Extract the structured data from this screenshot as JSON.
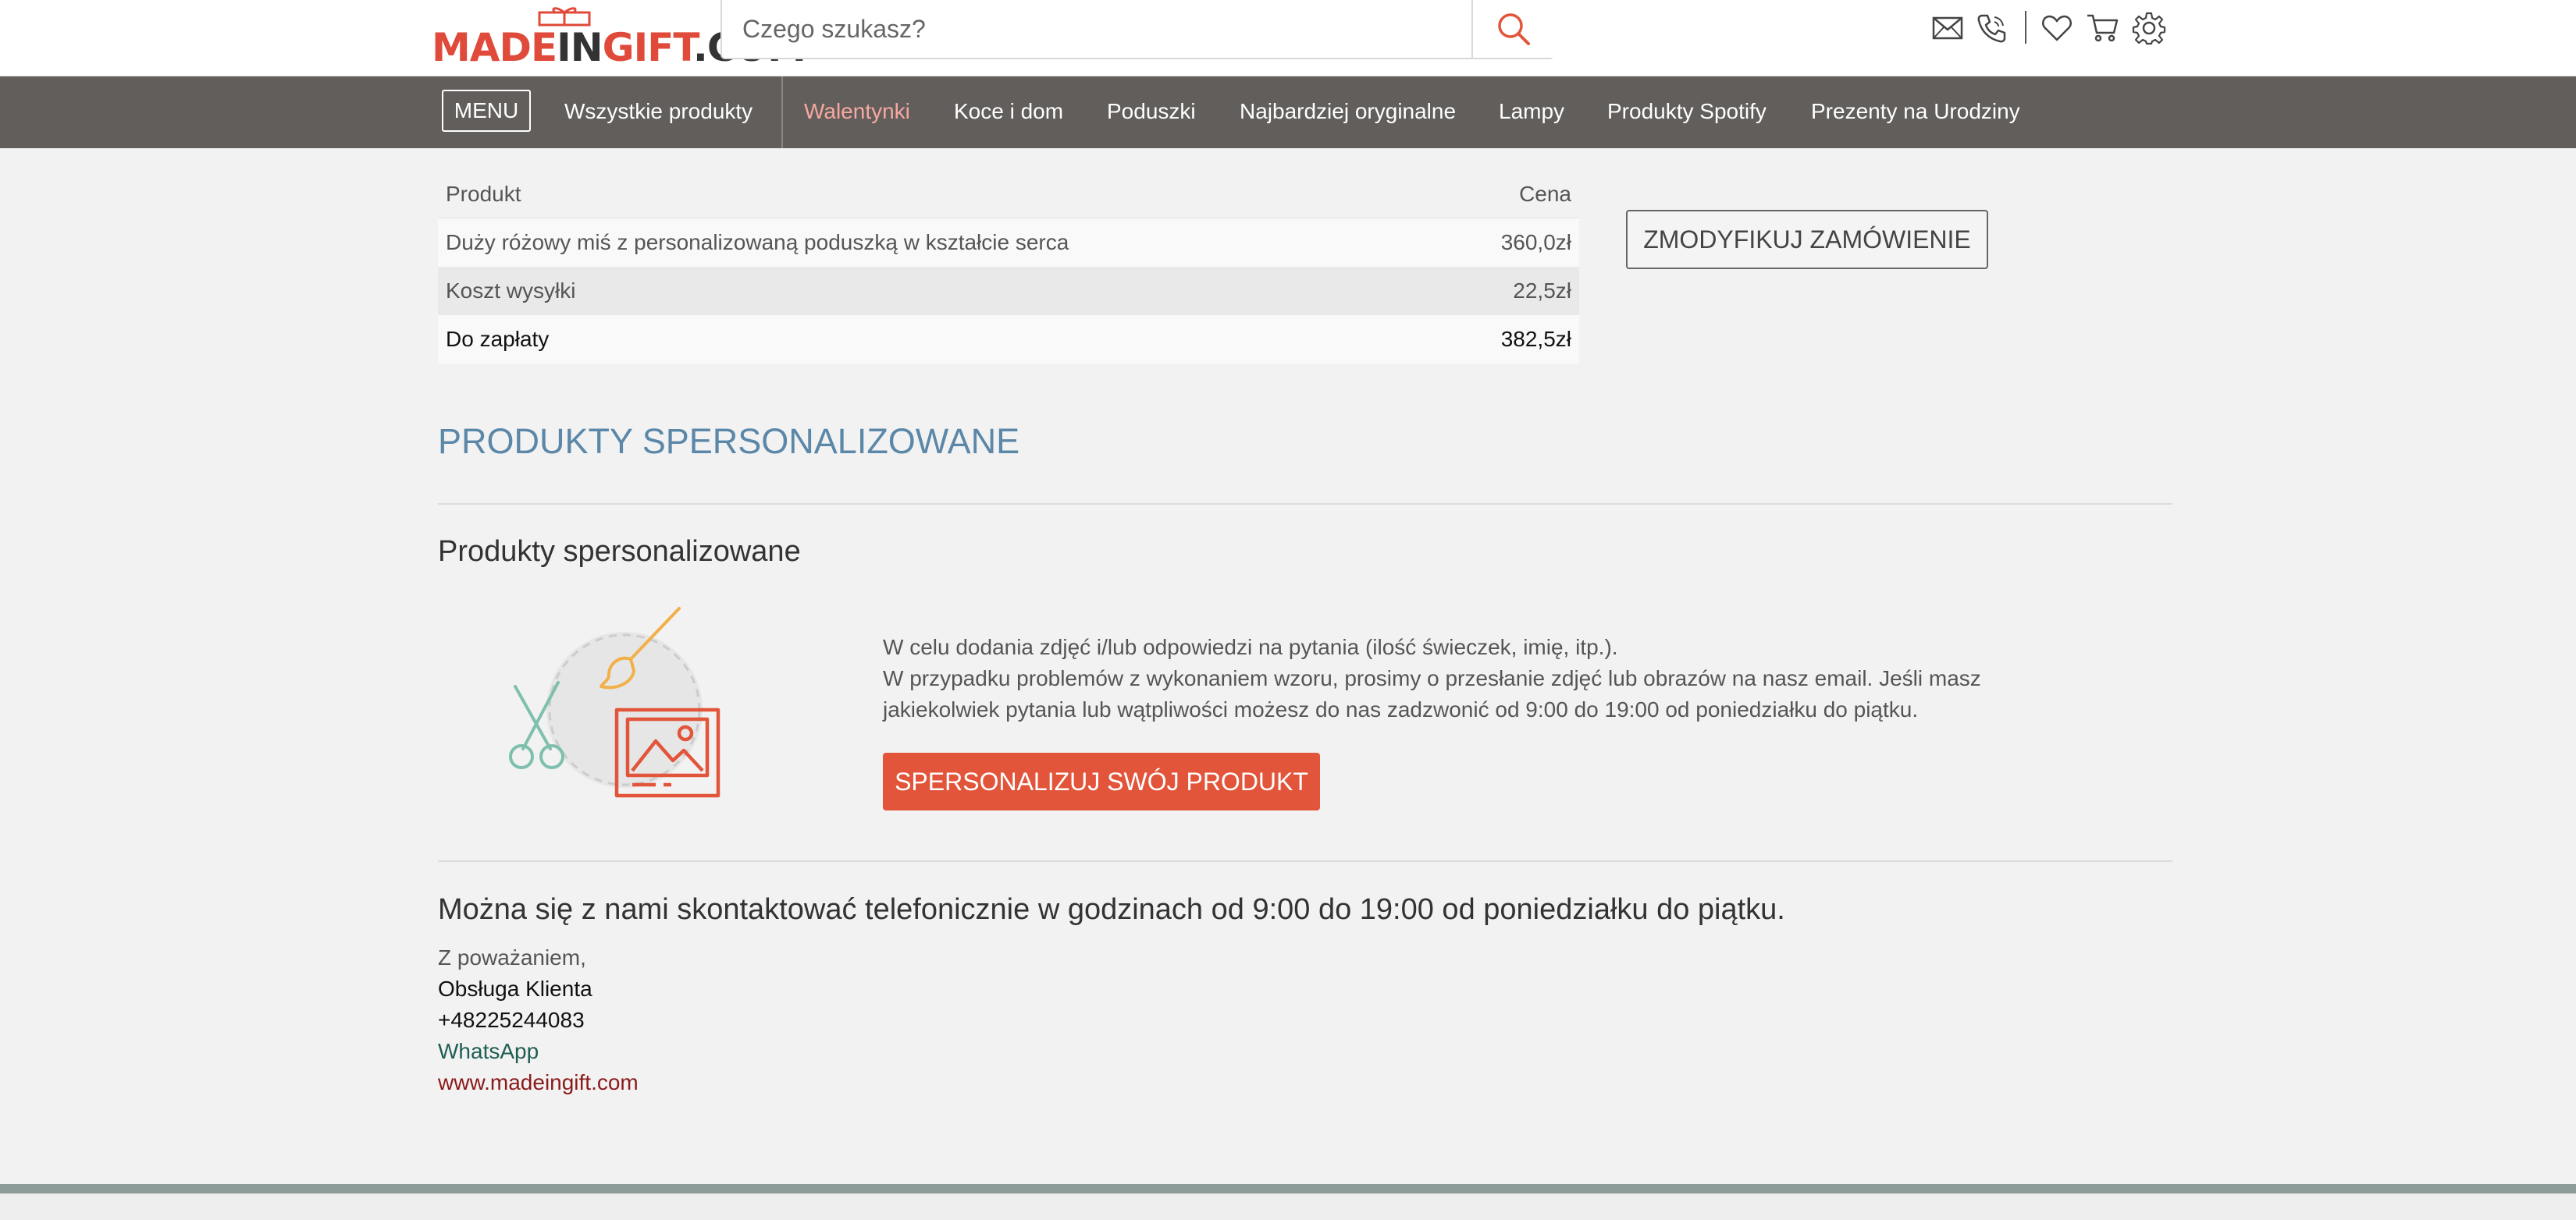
{
  "header": {
    "logo": {
      "part1": "MADE",
      "part2": "IN",
      "part3": "GIFT",
      "part4": ".COM"
    },
    "search": {
      "placeholder": "Czego szukasz?",
      "icon": "search-icon"
    },
    "icons": [
      "mail-icon",
      "phone-icon",
      "heart-icon",
      "cart-icon",
      "gear-icon"
    ]
  },
  "nav": {
    "menu_label": "MENU",
    "items": [
      {
        "label": "Wszystkie produkty",
        "active": false
      },
      {
        "label": "Walentynki",
        "active": true
      },
      {
        "label": "Koce i dom",
        "active": false
      },
      {
        "label": "Poduszki",
        "active": false
      },
      {
        "label": "Najbardziej oryginalne",
        "active": false
      },
      {
        "label": "Lampy",
        "active": false
      },
      {
        "label": "Produkty Spotify",
        "active": false
      },
      {
        "label": "Prezenty na Urodziny",
        "active": false
      }
    ]
  },
  "order": {
    "headers": {
      "product": "Produkt",
      "price": "Cena"
    },
    "rows": [
      {
        "product": "Duży różowy miś z personalizowaną poduszką w kształcie serca",
        "price": "360,0zł"
      },
      {
        "product": "Koszt wysyłki",
        "price": "22,5zł"
      },
      {
        "product": "Do zapłaty",
        "price": "382,5zł"
      }
    ],
    "modify_label": "ZMODYFIKUJ ZAMÓWIENIE"
  },
  "personalized": {
    "title": "PRODUKTY SPERSONALIZOWANE",
    "subheading": "Produkty spersonalizowane",
    "line1": "W celu dodania zdjęć i/lub odpowiedzi na pytania (ilość świeczek, imię, itp.).",
    "line2": "W przypadku problemów z wykonaniem wzoru, prosimy o przesłanie zdjęć lub obrazów na nasz email. Jeśli masz jakiekolwiek pytania lub wątpliwości możesz do nas zadzwonić od 9:00 do 19:00 od poniedziałku do piątku.",
    "button_label": "SPERSONALIZUJ SWÓJ PRODUKT"
  },
  "contact": {
    "heading": "Można się z nami skontaktować telefonicznie w godzinach od 9:00 do 19:00 od poniedziałku do piątku.",
    "greeting": "Z poważaniem,",
    "team": "Obsługa Klienta",
    "phone": "+48225244083",
    "whatsapp": "WhatsApp",
    "website": "www.madeingift.com"
  },
  "colors": {
    "accent": "#e2553a",
    "nav_bg": "#625e5c",
    "nav_active": "#f7a8a0",
    "section_title": "#5b87a8"
  }
}
